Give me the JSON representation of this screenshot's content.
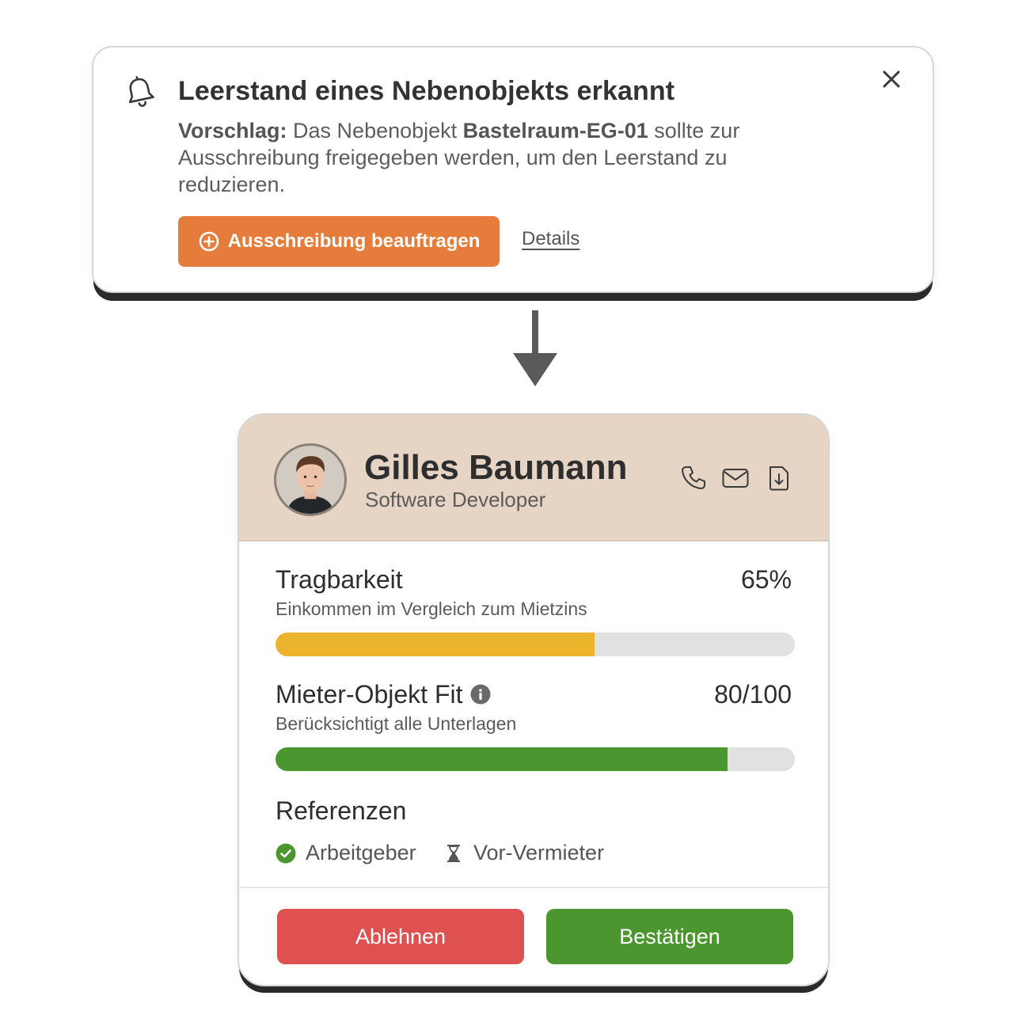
{
  "notification": {
    "title": "Leerstand eines Nebenobjekts erkannt",
    "suggestion_label": "Vorschlag:",
    "text_before_object": " Das Nebenobjekt ",
    "object_name": "Bastelraum-EG-01",
    "text_after_object": " sollte zur Ausschreibung freigegeben werden, um den Leerstand zu reduzieren.",
    "primary_button_label": "Ausschreibung beauftragen",
    "details_link_label": "Details",
    "icons": {
      "bell": "bell-icon",
      "close": "close-icon",
      "plus": "plus-circle-icon"
    },
    "accent_color": "#e57c3b"
  },
  "applicant": {
    "name": "Gilles Baumann",
    "role": "Software Developer",
    "header_color": "#e6d5c4",
    "icons": [
      "phone-icon",
      "mail-icon",
      "document-download-icon"
    ],
    "metrics": [
      {
        "label": "Tragbarkeit",
        "value_text": "65%",
        "subtitle": "Einkommen im Vergleich zum Mietzins",
        "fill_fraction": 0.615,
        "color": "#ecb32d"
      },
      {
        "label": "Mieter-Objekt Fit",
        "value_text": "80/100",
        "subtitle": "Berücksichtigt alle Unterlagen",
        "fill_fraction": 0.87,
        "color": "#4c962f",
        "has_info_icon": true
      }
    ],
    "references": {
      "title": "Referenzen",
      "items": [
        {
          "label": "Arbeitgeber",
          "status": "confirmed",
          "icon": "check-circle-icon"
        },
        {
          "label": "Vor-Vermieter",
          "status": "pending",
          "icon": "hourglass-icon"
        }
      ]
    },
    "reject_label": "Ablehnen",
    "confirm_label": "Bestätigen",
    "reject_color": "#df5151",
    "confirm_color": "#4c962f"
  }
}
